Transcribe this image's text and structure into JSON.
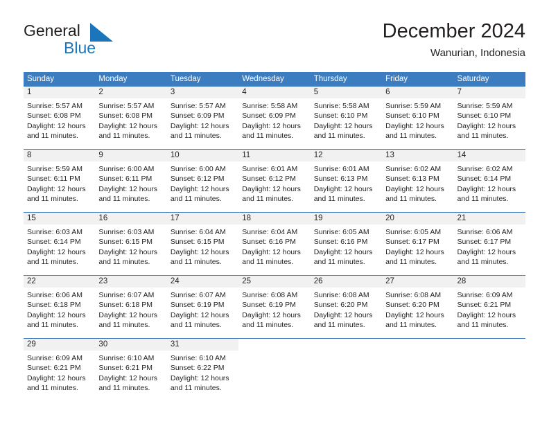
{
  "logo": {
    "word1": "General",
    "word2": "Blue",
    "flag_color": "#1b75bb",
    "text_color": "#231f20"
  },
  "header": {
    "title": "December 2024",
    "subtitle": "Wanurian, Indonesia"
  },
  "theme": {
    "header_blue": "#3b7dc0",
    "day_band_gray": "#f1f1f1",
    "text": "#231f20"
  },
  "weekdays": [
    "Sunday",
    "Monday",
    "Tuesday",
    "Wednesday",
    "Thursday",
    "Friday",
    "Saturday"
  ],
  "weeks": [
    [
      {
        "day": "1",
        "sunrise": "Sunrise: 5:57 AM",
        "sunset": "Sunset: 6:08 PM",
        "daylight": "Daylight: 12 hours and 11 minutes."
      },
      {
        "day": "2",
        "sunrise": "Sunrise: 5:57 AM",
        "sunset": "Sunset: 6:08 PM",
        "daylight": "Daylight: 12 hours and 11 minutes."
      },
      {
        "day": "3",
        "sunrise": "Sunrise: 5:57 AM",
        "sunset": "Sunset: 6:09 PM",
        "daylight": "Daylight: 12 hours and 11 minutes."
      },
      {
        "day": "4",
        "sunrise": "Sunrise: 5:58 AM",
        "sunset": "Sunset: 6:09 PM",
        "daylight": "Daylight: 12 hours and 11 minutes."
      },
      {
        "day": "5",
        "sunrise": "Sunrise: 5:58 AM",
        "sunset": "Sunset: 6:10 PM",
        "daylight": "Daylight: 12 hours and 11 minutes."
      },
      {
        "day": "6",
        "sunrise": "Sunrise: 5:59 AM",
        "sunset": "Sunset: 6:10 PM",
        "daylight": "Daylight: 12 hours and 11 minutes."
      },
      {
        "day": "7",
        "sunrise": "Sunrise: 5:59 AM",
        "sunset": "Sunset: 6:10 PM",
        "daylight": "Daylight: 12 hours and 11 minutes."
      }
    ],
    [
      {
        "day": "8",
        "sunrise": "Sunrise: 5:59 AM",
        "sunset": "Sunset: 6:11 PM",
        "daylight": "Daylight: 12 hours and 11 minutes."
      },
      {
        "day": "9",
        "sunrise": "Sunrise: 6:00 AM",
        "sunset": "Sunset: 6:11 PM",
        "daylight": "Daylight: 12 hours and 11 minutes."
      },
      {
        "day": "10",
        "sunrise": "Sunrise: 6:00 AM",
        "sunset": "Sunset: 6:12 PM",
        "daylight": "Daylight: 12 hours and 11 minutes."
      },
      {
        "day": "11",
        "sunrise": "Sunrise: 6:01 AM",
        "sunset": "Sunset: 6:12 PM",
        "daylight": "Daylight: 12 hours and 11 minutes."
      },
      {
        "day": "12",
        "sunrise": "Sunrise: 6:01 AM",
        "sunset": "Sunset: 6:13 PM",
        "daylight": "Daylight: 12 hours and 11 minutes."
      },
      {
        "day": "13",
        "sunrise": "Sunrise: 6:02 AM",
        "sunset": "Sunset: 6:13 PM",
        "daylight": "Daylight: 12 hours and 11 minutes."
      },
      {
        "day": "14",
        "sunrise": "Sunrise: 6:02 AM",
        "sunset": "Sunset: 6:14 PM",
        "daylight": "Daylight: 12 hours and 11 minutes."
      }
    ],
    [
      {
        "day": "15",
        "sunrise": "Sunrise: 6:03 AM",
        "sunset": "Sunset: 6:14 PM",
        "daylight": "Daylight: 12 hours and 11 minutes."
      },
      {
        "day": "16",
        "sunrise": "Sunrise: 6:03 AM",
        "sunset": "Sunset: 6:15 PM",
        "daylight": "Daylight: 12 hours and 11 minutes."
      },
      {
        "day": "17",
        "sunrise": "Sunrise: 6:04 AM",
        "sunset": "Sunset: 6:15 PM",
        "daylight": "Daylight: 12 hours and 11 minutes."
      },
      {
        "day": "18",
        "sunrise": "Sunrise: 6:04 AM",
        "sunset": "Sunset: 6:16 PM",
        "daylight": "Daylight: 12 hours and 11 minutes."
      },
      {
        "day": "19",
        "sunrise": "Sunrise: 6:05 AM",
        "sunset": "Sunset: 6:16 PM",
        "daylight": "Daylight: 12 hours and 11 minutes."
      },
      {
        "day": "20",
        "sunrise": "Sunrise: 6:05 AM",
        "sunset": "Sunset: 6:17 PM",
        "daylight": "Daylight: 12 hours and 11 minutes."
      },
      {
        "day": "21",
        "sunrise": "Sunrise: 6:06 AM",
        "sunset": "Sunset: 6:17 PM",
        "daylight": "Daylight: 12 hours and 11 minutes."
      }
    ],
    [
      {
        "day": "22",
        "sunrise": "Sunrise: 6:06 AM",
        "sunset": "Sunset: 6:18 PM",
        "daylight": "Daylight: 12 hours and 11 minutes."
      },
      {
        "day": "23",
        "sunrise": "Sunrise: 6:07 AM",
        "sunset": "Sunset: 6:18 PM",
        "daylight": "Daylight: 12 hours and 11 minutes."
      },
      {
        "day": "24",
        "sunrise": "Sunrise: 6:07 AM",
        "sunset": "Sunset: 6:19 PM",
        "daylight": "Daylight: 12 hours and 11 minutes."
      },
      {
        "day": "25",
        "sunrise": "Sunrise: 6:08 AM",
        "sunset": "Sunset: 6:19 PM",
        "daylight": "Daylight: 12 hours and 11 minutes."
      },
      {
        "day": "26",
        "sunrise": "Sunrise: 6:08 AM",
        "sunset": "Sunset: 6:20 PM",
        "daylight": "Daylight: 12 hours and 11 minutes."
      },
      {
        "day": "27",
        "sunrise": "Sunrise: 6:08 AM",
        "sunset": "Sunset: 6:20 PM",
        "daylight": "Daylight: 12 hours and 11 minutes."
      },
      {
        "day": "28",
        "sunrise": "Sunrise: 6:09 AM",
        "sunset": "Sunset: 6:21 PM",
        "daylight": "Daylight: 12 hours and 11 minutes."
      }
    ],
    [
      {
        "day": "29",
        "sunrise": "Sunrise: 6:09 AM",
        "sunset": "Sunset: 6:21 PM",
        "daylight": "Daylight: 12 hours and 11 minutes."
      },
      {
        "day": "30",
        "sunrise": "Sunrise: 6:10 AM",
        "sunset": "Sunset: 6:21 PM",
        "daylight": "Daylight: 12 hours and 11 minutes."
      },
      {
        "day": "31",
        "sunrise": "Sunrise: 6:10 AM",
        "sunset": "Sunset: 6:22 PM",
        "daylight": "Daylight: 12 hours and 11 minutes."
      },
      {
        "day": "",
        "sunrise": "",
        "sunset": "",
        "daylight": ""
      },
      {
        "day": "",
        "sunrise": "",
        "sunset": "",
        "daylight": ""
      },
      {
        "day": "",
        "sunrise": "",
        "sunset": "",
        "daylight": ""
      },
      {
        "day": "",
        "sunrise": "",
        "sunset": "",
        "daylight": ""
      }
    ]
  ]
}
